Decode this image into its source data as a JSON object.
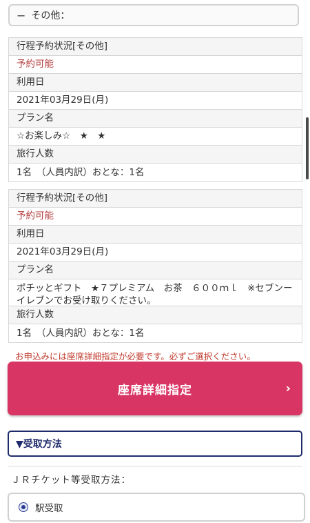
{
  "section": {
    "toggle": "−",
    "title": "その他："
  },
  "cards": [
    {
      "status_label": "行程予約状況[その他]",
      "status_value": "予約可能",
      "date_label": "利用日",
      "date_value": "2021年03月29日(月)",
      "plan_label": "プラン名",
      "plan_value": "☆お楽しみ☆　★　★",
      "people_label": "旅行人数",
      "people_value": "1名　（人員内訳）おとな：1名"
    },
    {
      "status_label": "行程予約状況[その他]",
      "status_value": "予約可能",
      "date_label": "利用日",
      "date_value": "2021年03月29日(月)",
      "plan_label": "プラン名",
      "plan_value": "ポチッとギフト　★７プレミアム　お茶　６００ｍｌ　※セブンーイレブンでお受け取りください。",
      "people_label": "旅行人数",
      "people_value": "1名　（人員内訳）おとな：1名"
    }
  ],
  "warning": "お申込みには座席詳細指定が必要です。必ずご選択ください。",
  "seat_button": {
    "label": "座席詳細指定",
    "chevron": "›"
  },
  "receive": {
    "label": "▼受取方法"
  },
  "ticket_receive_title": "ＪＲチケット等受取方法：",
  "receive_option": {
    "label": "駅受取"
  },
  "colors": {
    "accent": "#d93564",
    "navy": "#1e2a6b",
    "status_red": "#b33a3a"
  }
}
